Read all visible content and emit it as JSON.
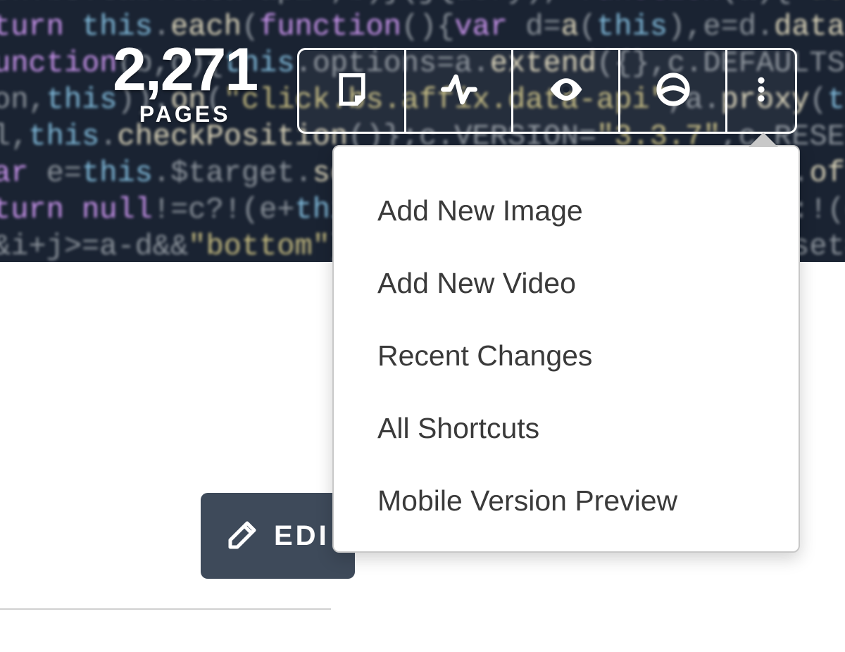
{
  "pages": {
    "count": "2,271",
    "label": "PAGES"
  },
  "toolbar": {
    "icons": [
      "note-icon",
      "activity-icon",
      "eye-icon",
      "community-icon",
      "more-icon"
    ]
  },
  "dropdown": {
    "items": [
      "Add New Image",
      "Add New Video",
      "Recent Changes",
      "All Shortcuts",
      "Mobile Version Preview"
    ]
  },
  "editButton": {
    "label": "EDI"
  },
  "codeBackground": "ck.bs.tab.data-api\",b)}(jQuery),+function(a){\"use strict\";function b(b){re\nturn this.each(function(){var d=a(this),e=d.data(\"bs.\nunction(b,d){this.options=a.extend({},c.DEFAULTS,d),this.$targe\non,this)).on(\"click.bs.affix.data-api\",a.proxy(this.checkPositi\nl,this.checkPosition()};c.VERSION=\"3.3.7\",c.RESET=\"affix affix\nar e=this.$target.scrollTop(),f=this.$element.offset(),g=this.\nturn null!=c?!(e+this.unpin<=f.top)&&\"bottom\":!(e+g<=a-d)&&\"bo\n&i+j>=a-d&&\"bottom\"},c.prototype.getPinnedOffset=function(){if"
}
